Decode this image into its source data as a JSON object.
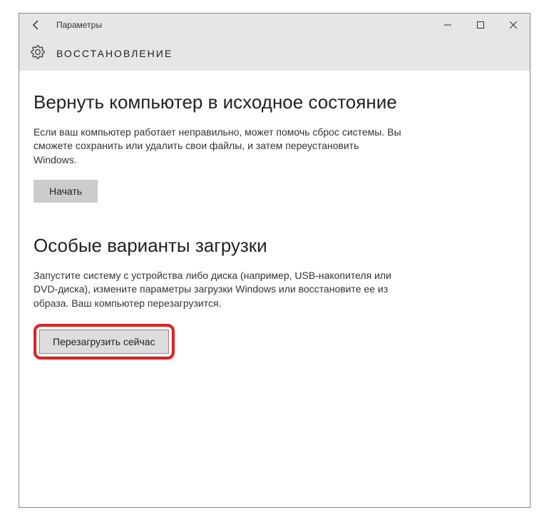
{
  "titlebar": {
    "title": "Параметры"
  },
  "header": {
    "title": "ВОССТАНОВЛЕНИЕ"
  },
  "section1": {
    "heading": "Вернуть компьютер в исходное состояние",
    "body": "Если ваш компьютер работает неправильно, может помочь сброс системы. Вы сможете сохранить или удалить свои файлы, и затем переустановить Windows.",
    "button": "Начать"
  },
  "section2": {
    "heading": "Особые варианты загрузки",
    "body": "Запустите систему с устройства либо диска (например, USB-накопителя или DVD-диска), измените параметры загрузки Windows или восстановите ее из образа. Ваш компьютер перезагрузится.",
    "button": "Перезагрузить сейчас"
  }
}
